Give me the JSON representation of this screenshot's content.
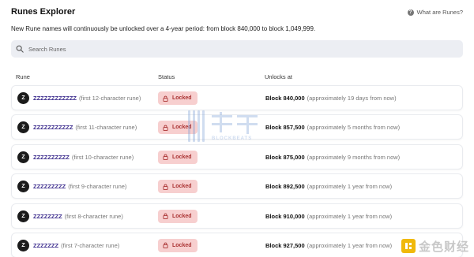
{
  "header": {
    "title": "Runes Explorer",
    "help_label": "What are Runes?",
    "help_icon": "question-icon"
  },
  "subtitle": "New Rune names will continuously be unlocked over a 4-year period: from block 840,000 to block 1,049,999.",
  "search": {
    "placeholder": "Search Runes",
    "value": ""
  },
  "table": {
    "columns": [
      "Rune",
      "Status",
      "Unlocks at"
    ],
    "rows": [
      {
        "avatar": "Z",
        "name": "ZZZZZZZZZZZZ",
        "note": "(first 12-character rune)",
        "status": "Locked",
        "block": "Block 840,000",
        "eta": "(approximately 19 days from now)"
      },
      {
        "avatar": "Z",
        "name": "ZZZZZZZZZZZ",
        "note": "(first 11-character rune)",
        "status": "Locked",
        "block": "Block 857,500",
        "eta": "(approximately 5 months from now)"
      },
      {
        "avatar": "Z",
        "name": "ZZZZZZZZZZ",
        "note": "(first 10-character rune)",
        "status": "Locked",
        "block": "Block 875,000",
        "eta": "(approximately 9 months from now)"
      },
      {
        "avatar": "Z",
        "name": "ZZZZZZZZZ",
        "note": "(first 9-character rune)",
        "status": "Locked",
        "block": "Block 892,500",
        "eta": "(approximately 1 year from now)"
      },
      {
        "avatar": "Z",
        "name": "ZZZZZZZZ",
        "note": "(first 8-character rune)",
        "status": "Locked",
        "block": "Block 910,000",
        "eta": "(approximately 1 year from now)"
      },
      {
        "avatar": "Z",
        "name": "ZZZZZZZ",
        "note": "(first 7-character rune)",
        "status": "Locked",
        "block": "Block 927,500",
        "eta": "(approximately 1 year from now)"
      }
    ]
  },
  "watermark": {
    "sub": "BLOCKBEATS"
  },
  "logo": {
    "text": "金色财经"
  },
  "colors": {
    "accent": "#3a2a8c",
    "locked_bg": "#f7cfcf",
    "locked_text": "#aa3333",
    "search_bg": "#eceef3",
    "logo_gold": "#f0b90b"
  }
}
